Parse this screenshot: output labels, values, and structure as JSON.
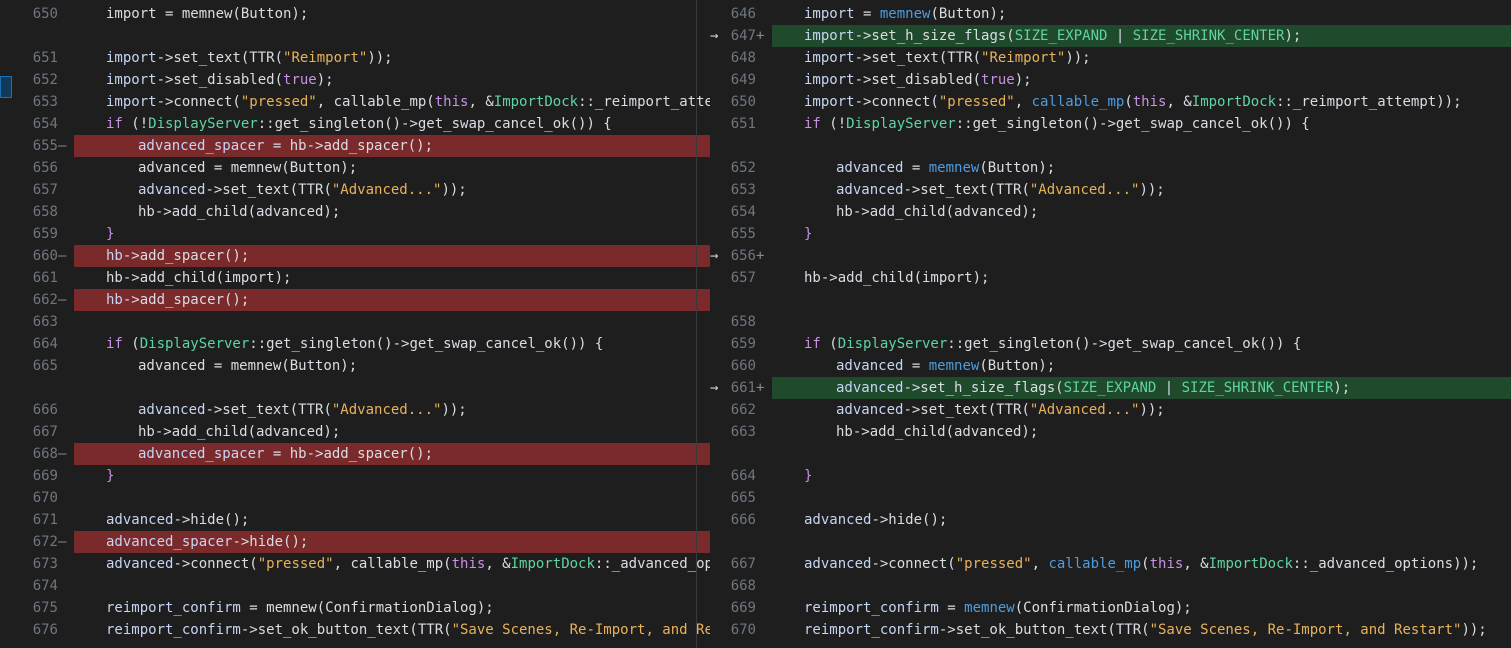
{
  "left": {
    "rows": [
      {
        "ln": "650",
        "mark": "",
        "type": "ctx",
        "indent": 0,
        "code": [
          [
            "plain",
            "import = memnew(Button);"
          ]
        ]
      },
      {
        "ln": "",
        "mark": "",
        "type": "hatch",
        "indent": 0,
        "code": []
      },
      {
        "ln": "651",
        "mark": "",
        "type": "ctx",
        "indent": 0,
        "code": [
          [
            "var",
            "import"
          ],
          [
            "plain",
            "->set_text(TTR("
          ],
          [
            "str",
            "\"Reimport\""
          ],
          [
            "plain",
            "));"
          ]
        ]
      },
      {
        "ln": "652",
        "mark": "",
        "type": "ctx",
        "indent": 0,
        "code": [
          [
            "var",
            "import"
          ],
          [
            "plain",
            "->set_disabled("
          ],
          [
            "kw",
            "true"
          ],
          [
            "plain",
            ");"
          ]
        ]
      },
      {
        "ln": "653",
        "mark": "",
        "type": "ctx",
        "indent": 0,
        "code": [
          [
            "var",
            "import"
          ],
          [
            "plain",
            "->connect("
          ],
          [
            "str",
            "\"pressed\""
          ],
          [
            "plain",
            ", callable_mp("
          ],
          [
            "kw",
            "this"
          ],
          [
            "plain",
            ", &"
          ],
          [
            "type",
            "ImportDock"
          ],
          [
            "plain",
            "::_reimport_attempt)"
          ]
        ]
      },
      {
        "ln": "654",
        "mark": "",
        "type": "ctx",
        "indent": 0,
        "code": [
          [
            "kw",
            "if"
          ],
          [
            "plain",
            " (!"
          ],
          [
            "type",
            "DisplayServer"
          ],
          [
            "plain",
            "::get_singleton()->get_swap_cancel_ok()) {"
          ]
        ]
      },
      {
        "ln": "655",
        "mark": "—",
        "type": "del",
        "indent": 1,
        "code": [
          [
            "var",
            "advanced_spacer"
          ],
          [
            "plain",
            " = hb->add_spacer();"
          ]
        ],
        "gutter": "→"
      },
      {
        "ln": "656",
        "mark": "",
        "type": "ctx",
        "indent": 1,
        "code": [
          [
            "plain",
            "advanced = memnew(Button);"
          ]
        ]
      },
      {
        "ln": "657",
        "mark": "",
        "type": "ctx",
        "indent": 1,
        "code": [
          [
            "var",
            "advanced"
          ],
          [
            "plain",
            "->set_text(TTR("
          ],
          [
            "str",
            "\"Advanced...\""
          ],
          [
            "plain",
            "));"
          ]
        ]
      },
      {
        "ln": "658",
        "mark": "",
        "type": "ctx",
        "indent": 1,
        "code": [
          [
            "plain",
            "hb->add_child(advanced);"
          ]
        ]
      },
      {
        "ln": "659",
        "mark": "",
        "type": "ctx",
        "indent": 0,
        "code": [
          [
            "kw",
            "}"
          ]
        ]
      },
      {
        "ln": "660",
        "mark": "—",
        "type": "del",
        "indent": 0,
        "code": [
          [
            "var",
            "hb"
          ],
          [
            "plain",
            "->add_spacer();"
          ]
        ],
        "gutter": "→"
      },
      {
        "ln": "661",
        "mark": "",
        "type": "ctx",
        "indent": 0,
        "code": [
          [
            "plain",
            "hb->add_child(import);"
          ]
        ]
      },
      {
        "ln": "662",
        "mark": "—",
        "type": "del",
        "indent": 0,
        "code": [
          [
            "var",
            "hb"
          ],
          [
            "plain",
            "->add_spacer();"
          ]
        ],
        "gutter": "→"
      },
      {
        "ln": "663",
        "mark": "",
        "type": "ctx",
        "indent": 0,
        "code": []
      },
      {
        "ln": "664",
        "mark": "",
        "type": "ctx",
        "indent": 0,
        "code": [
          [
            "kw",
            "if"
          ],
          [
            "plain",
            " ("
          ],
          [
            "type",
            "DisplayServer"
          ],
          [
            "plain",
            "::get_singleton()->get_swap_cancel_ok()) {"
          ]
        ]
      },
      {
        "ln": "665",
        "mark": "",
        "type": "ctx",
        "indent": 1,
        "code": [
          [
            "plain",
            "advanced = memnew(Button);"
          ]
        ]
      },
      {
        "ln": "",
        "mark": "",
        "type": "hatch",
        "indent": 0,
        "code": [],
        "gutter": "→"
      },
      {
        "ln": "666",
        "mark": "",
        "type": "ctx",
        "indent": 1,
        "code": [
          [
            "var",
            "advanced"
          ],
          [
            "plain",
            "->set_text(TTR("
          ],
          [
            "str",
            "\"Advanced...\""
          ],
          [
            "plain",
            "));"
          ]
        ]
      },
      {
        "ln": "667",
        "mark": "",
        "type": "ctx",
        "indent": 1,
        "code": [
          [
            "plain",
            "hb->add_child(advanced);"
          ]
        ]
      },
      {
        "ln": "668",
        "mark": "—",
        "type": "del",
        "indent": 1,
        "code": [
          [
            "var",
            "advanced_spacer"
          ],
          [
            "plain",
            " = hb->add_spacer();"
          ]
        ],
        "gutter": "→"
      },
      {
        "ln": "669",
        "mark": "",
        "type": "ctx",
        "indent": 0,
        "code": [
          [
            "kw",
            "}"
          ]
        ]
      },
      {
        "ln": "670",
        "mark": "",
        "type": "ctx",
        "indent": 0,
        "code": []
      },
      {
        "ln": "671",
        "mark": "",
        "type": "ctx",
        "indent": 0,
        "code": [
          [
            "var",
            "advanced"
          ],
          [
            "plain",
            "->hide();"
          ]
        ]
      },
      {
        "ln": "672",
        "mark": "—",
        "type": "del",
        "indent": 0,
        "code": [
          [
            "var",
            "advanced_spacer"
          ],
          [
            "plain",
            "->hide();"
          ]
        ],
        "gutter": "→"
      },
      {
        "ln": "673",
        "mark": "",
        "type": "ctx",
        "indent": 0,
        "code": [
          [
            "var",
            "advanced"
          ],
          [
            "plain",
            "->connect("
          ],
          [
            "str",
            "\"pressed\""
          ],
          [
            "plain",
            ", callable_mp("
          ],
          [
            "kw",
            "this"
          ],
          [
            "plain",
            ", &"
          ],
          [
            "type",
            "ImportDock"
          ],
          [
            "plain",
            "::_advanced_option"
          ]
        ]
      },
      {
        "ln": "674",
        "mark": "",
        "type": "ctx",
        "indent": 0,
        "code": []
      },
      {
        "ln": "675",
        "mark": "",
        "type": "ctx",
        "indent": 0,
        "code": [
          [
            "var",
            "reimport_confirm"
          ],
          [
            "plain",
            " = memnew(ConfirmationDialog);"
          ]
        ]
      },
      {
        "ln": "676",
        "mark": "",
        "type": "ctx",
        "indent": 0,
        "code": [
          [
            "var",
            "reimport_confirm"
          ],
          [
            "plain",
            "->set_ok_button_text(TTR("
          ],
          [
            "str",
            "\"Save Scenes, Re-Import, and Restar"
          ]
        ]
      }
    ]
  },
  "right": {
    "rows": [
      {
        "ln": "646",
        "mark": "",
        "type": "ctx",
        "indent": 0,
        "code": [
          [
            "var",
            "import"
          ],
          [
            "plain",
            " = "
          ],
          [
            "fn",
            "memnew"
          ],
          [
            "plain",
            "(Button);"
          ]
        ]
      },
      {
        "ln": "647",
        "mark": "+",
        "type": "add",
        "indent": 0,
        "code": [
          [
            "var",
            "import"
          ],
          [
            "plain",
            "->set_h_size_flags("
          ],
          [
            "type",
            "SIZE_EXPAND"
          ],
          [
            "plain",
            " | "
          ],
          [
            "type",
            "SIZE_SHRINK_CENTER"
          ],
          [
            "plain",
            ");"
          ]
        ],
        "gutter": "→"
      },
      {
        "ln": "648",
        "mark": "",
        "type": "ctx",
        "indent": 0,
        "code": [
          [
            "var",
            "import"
          ],
          [
            "plain",
            "->set_text(TTR("
          ],
          [
            "str",
            "\"Reimport\""
          ],
          [
            "plain",
            "));"
          ]
        ]
      },
      {
        "ln": "649",
        "mark": "",
        "type": "ctx",
        "indent": 0,
        "code": [
          [
            "var",
            "import"
          ],
          [
            "plain",
            "->set_disabled("
          ],
          [
            "kw",
            "true"
          ],
          [
            "plain",
            ");"
          ]
        ]
      },
      {
        "ln": "650",
        "mark": "",
        "type": "ctx",
        "indent": 0,
        "code": [
          [
            "var",
            "import"
          ],
          [
            "plain",
            "->connect("
          ],
          [
            "str",
            "\"pressed\""
          ],
          [
            "plain",
            ", "
          ],
          [
            "fn",
            "callable_mp"
          ],
          [
            "plain",
            "("
          ],
          [
            "kw",
            "this"
          ],
          [
            "plain",
            ", &"
          ],
          [
            "type",
            "ImportDock"
          ],
          [
            "plain",
            "::_reimport_attempt));"
          ]
        ]
      },
      {
        "ln": "651",
        "mark": "",
        "type": "ctx",
        "indent": 0,
        "code": [
          [
            "kw",
            "if"
          ],
          [
            "plain",
            " (!"
          ],
          [
            "type",
            "DisplayServer"
          ],
          [
            "plain",
            "::get_singleton()->get_swap_cancel_ok()) {"
          ]
        ]
      },
      {
        "ln": "",
        "mark": "",
        "type": "hatch",
        "indent": 0,
        "code": []
      },
      {
        "ln": "652",
        "mark": "",
        "type": "ctx",
        "indent": 1,
        "code": [
          [
            "var",
            "advanced"
          ],
          [
            "plain",
            " = "
          ],
          [
            "fn",
            "memnew"
          ],
          [
            "plain",
            "(Button);"
          ]
        ]
      },
      {
        "ln": "653",
        "mark": "",
        "type": "ctx",
        "indent": 1,
        "code": [
          [
            "var",
            "advanced"
          ],
          [
            "plain",
            "->set_text(TTR("
          ],
          [
            "str",
            "\"Advanced...\""
          ],
          [
            "plain",
            "));"
          ]
        ]
      },
      {
        "ln": "654",
        "mark": "",
        "type": "ctx",
        "indent": 1,
        "code": [
          [
            "plain",
            "hb->add_child(advanced);"
          ]
        ]
      },
      {
        "ln": "655",
        "mark": "",
        "type": "ctx",
        "indent": 0,
        "code": [
          [
            "kw",
            "}"
          ]
        ]
      },
      {
        "ln": "656",
        "mark": "+",
        "type": "add",
        "indent": 0,
        "code": [],
        "gutter": "→"
      },
      {
        "ln": "657",
        "mark": "",
        "type": "ctx",
        "indent": 0,
        "code": [
          [
            "plain",
            "hb->add_child(import);"
          ]
        ]
      },
      {
        "ln": "",
        "mark": "",
        "type": "hatch",
        "indent": 0,
        "code": []
      },
      {
        "ln": "658",
        "mark": "",
        "type": "ctx",
        "indent": 0,
        "code": []
      },
      {
        "ln": "659",
        "mark": "",
        "type": "ctx",
        "indent": 0,
        "code": [
          [
            "kw",
            "if"
          ],
          [
            "plain",
            " ("
          ],
          [
            "type",
            "DisplayServer"
          ],
          [
            "plain",
            "::get_singleton()->get_swap_cancel_ok()) {"
          ]
        ]
      },
      {
        "ln": "660",
        "mark": "",
        "type": "ctx",
        "indent": 1,
        "code": [
          [
            "var",
            "advanced"
          ],
          [
            "plain",
            " = "
          ],
          [
            "fn",
            "memnew"
          ],
          [
            "plain",
            "(Button);"
          ]
        ]
      },
      {
        "ln": "661",
        "mark": "+",
        "type": "add",
        "indent": 1,
        "code": [
          [
            "var",
            "advanced"
          ],
          [
            "plain",
            "->set_h_size_flags("
          ],
          [
            "type",
            "SIZE_EXPAND"
          ],
          [
            "plain",
            " | "
          ],
          [
            "type",
            "SIZE_SHRINK_CENTER"
          ],
          [
            "plain",
            ");"
          ]
        ],
        "gutter": "→"
      },
      {
        "ln": "662",
        "mark": "",
        "type": "ctx",
        "indent": 1,
        "code": [
          [
            "var",
            "advanced"
          ],
          [
            "plain",
            "->set_text(TTR("
          ],
          [
            "str",
            "\"Advanced...\""
          ],
          [
            "plain",
            "));"
          ]
        ]
      },
      {
        "ln": "663",
        "mark": "",
        "type": "ctx",
        "indent": 1,
        "code": [
          [
            "plain",
            "hb->add_child(advanced);"
          ]
        ]
      },
      {
        "ln": "",
        "mark": "",
        "type": "hatch",
        "indent": 0,
        "code": []
      },
      {
        "ln": "664",
        "mark": "",
        "type": "ctx",
        "indent": 0,
        "code": [
          [
            "kw",
            "}"
          ]
        ]
      },
      {
        "ln": "665",
        "mark": "",
        "type": "ctx",
        "indent": 0,
        "code": []
      },
      {
        "ln": "666",
        "mark": "",
        "type": "ctx",
        "indent": 0,
        "code": [
          [
            "var",
            "advanced"
          ],
          [
            "plain",
            "->hide();"
          ]
        ]
      },
      {
        "ln": "",
        "mark": "",
        "type": "hatch",
        "indent": 0,
        "code": []
      },
      {
        "ln": "667",
        "mark": "",
        "type": "ctx",
        "indent": 0,
        "code": [
          [
            "var",
            "advanced"
          ],
          [
            "plain",
            "->connect("
          ],
          [
            "str",
            "\"pressed\""
          ],
          [
            "plain",
            ", "
          ],
          [
            "fn",
            "callable_mp"
          ],
          [
            "plain",
            "("
          ],
          [
            "kw",
            "this"
          ],
          [
            "plain",
            ", &"
          ],
          [
            "type",
            "ImportDock"
          ],
          [
            "plain",
            "::_advanced_options));"
          ]
        ]
      },
      {
        "ln": "668",
        "mark": "",
        "type": "ctx",
        "indent": 0,
        "code": []
      },
      {
        "ln": "669",
        "mark": "",
        "type": "ctx",
        "indent": 0,
        "code": [
          [
            "var",
            "reimport_confirm"
          ],
          [
            "plain",
            " = "
          ],
          [
            "fn",
            "memnew"
          ],
          [
            "plain",
            "(ConfirmationDialog);"
          ]
        ]
      },
      {
        "ln": "670",
        "mark": "",
        "type": "ctx",
        "indent": 0,
        "code": [
          [
            "var",
            "reimport_confirm"
          ],
          [
            "plain",
            "->set_ok_button_text(TTR("
          ],
          [
            "str",
            "\"Save Scenes, Re-Import, and Restart\""
          ],
          [
            "plain",
            "));"
          ]
        ]
      }
    ]
  }
}
